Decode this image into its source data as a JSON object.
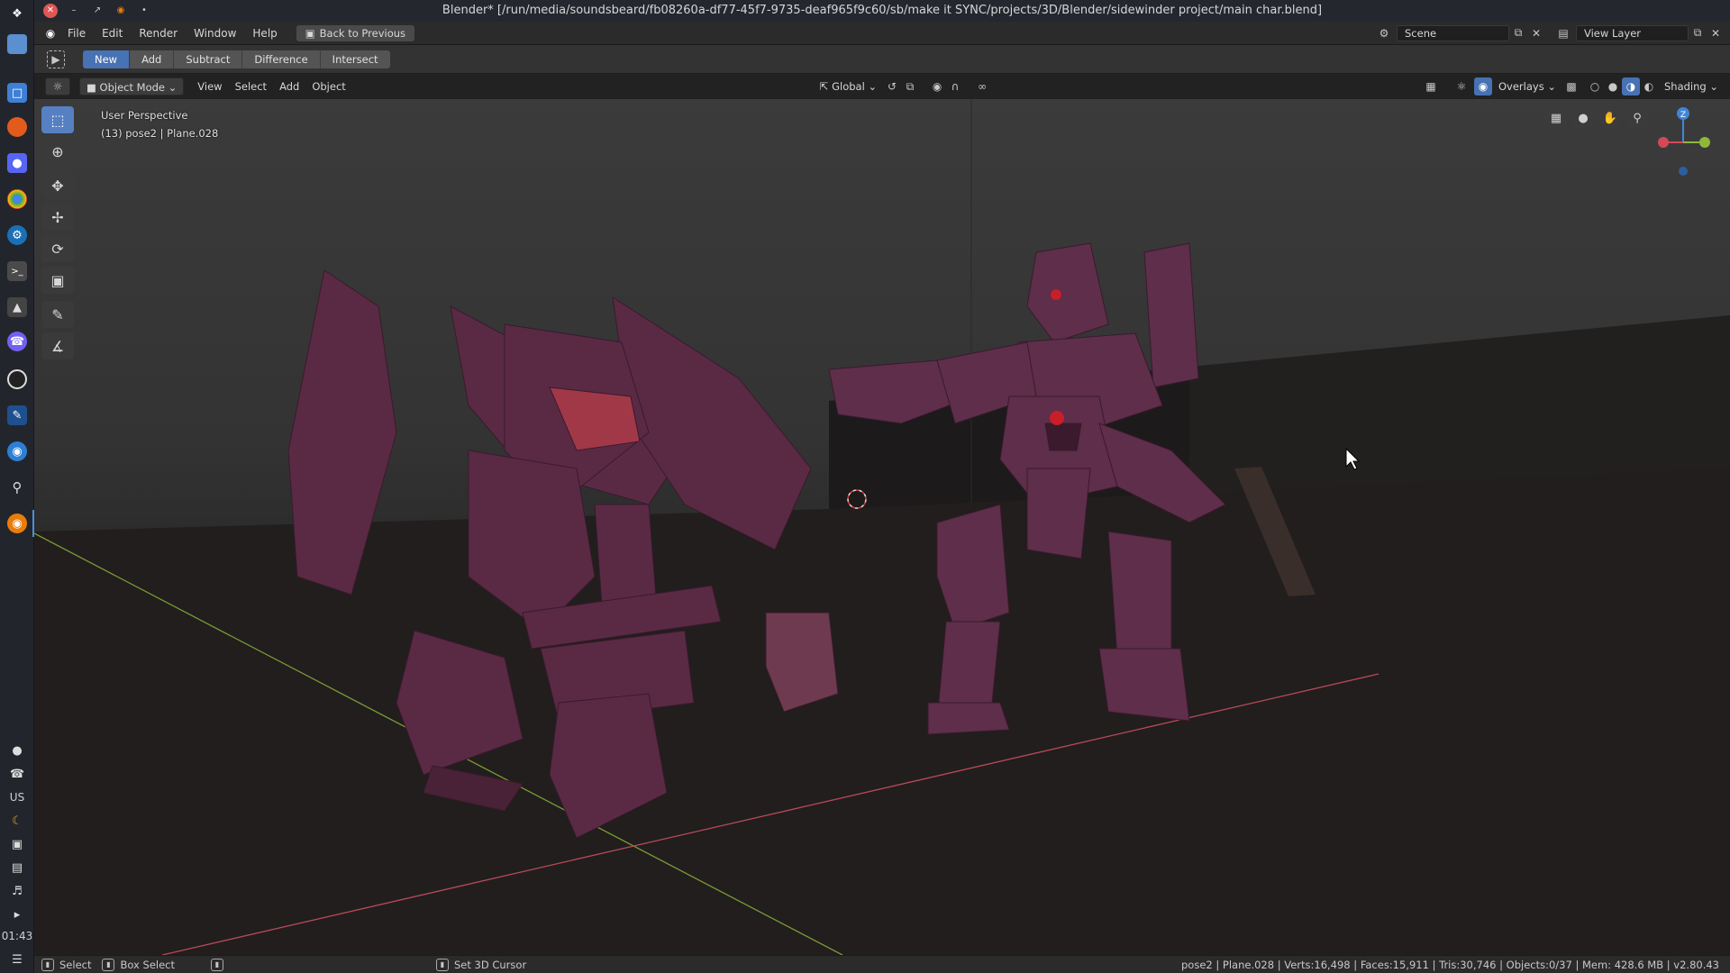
{
  "titlebar": {
    "title": "Blender* [/run/media/soundsbeard/fb08260a-df77-45f7-9735-deaf965f9c60/sb/make it SYNC/projects/3D/Blender/sidewinder project/main char.blend]"
  },
  "dock": {
    "locale": "US",
    "clock": "01:43",
    "icons": [
      "app-menu-icon",
      "desktop-icon",
      "files-icon",
      "firefox-icon",
      "discord-icon",
      "chrome-icon",
      "steam-icon",
      "terminal-icon",
      "game-icon",
      "viber-icon",
      "obs-icon",
      "krita-icon",
      "browser-icon",
      "search-icon",
      "blender-icon"
    ]
  },
  "menubar": {
    "items": [
      "File",
      "Edit",
      "Render",
      "Window",
      "Help"
    ],
    "back_button": "Back to Previous",
    "scene_label": "Scene",
    "view_layer_label": "View Layer"
  },
  "tool_settings": {
    "modes": [
      "New",
      "Add",
      "Subtract",
      "Difference",
      "Intersect"
    ],
    "active_mode": "New"
  },
  "viewport_header": {
    "mode": "Object Mode",
    "menus": [
      "View",
      "Select",
      "Add",
      "Object"
    ],
    "transform_orientation": "Global",
    "overlays": "Overlays",
    "shading": "Shading"
  },
  "viewport": {
    "perspective": "User Perspective",
    "object_info": "(13) pose2 | Plane.028",
    "gizmo_axis_z": "Z"
  },
  "toolbar": {
    "tools": [
      "select-box-tool",
      "cursor-tool",
      "move-tool",
      "move-arrows-tool",
      "rotate-tool",
      "scale-tool",
      "annotate-tool",
      "measure-tool"
    ],
    "active_tool": "select-box-tool"
  },
  "statusbar": {
    "select": "Select",
    "box_select": "Box Select",
    "set_cursor": "Set 3D Cursor",
    "stats": "pose2 | Plane.028 | Verts:16,498 | Faces:15,911 | Tris:30,746 | Objects:0/37 | Mem: 428.6 MB | v2.80.43"
  },
  "colors": {
    "accent": "#4772b3",
    "x_axis": "#d24a55",
    "y_axis": "#8fb73a",
    "z_axis": "#3f86d8",
    "mech": "#5e2e4a"
  }
}
